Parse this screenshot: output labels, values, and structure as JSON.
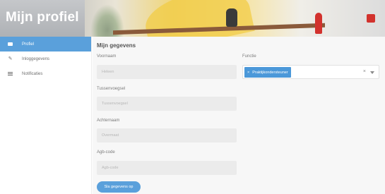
{
  "header": {
    "title": "Mijn profiel"
  },
  "sidebar": {
    "items": [
      {
        "label": "Profiel",
        "icon": "card-icon",
        "active": true
      },
      {
        "label": "Inloggegevens",
        "icon": "pencil-icon",
        "active": false
      },
      {
        "label": "Notificaties",
        "icon": "list-icon",
        "active": false
      }
    ]
  },
  "main": {
    "section_title": "Mijn gegevens",
    "fields": {
      "voornaam": {
        "label": "Voornaam",
        "value": "Heleen"
      },
      "tussenvoegsel": {
        "label": "Tussenvoegsel",
        "value": "Tussenvoegsel"
      },
      "achternaam": {
        "label": "Achternaam",
        "value": "Overmaat"
      },
      "agb": {
        "label": "Agb-code",
        "value": "Agb-code"
      }
    },
    "functie": {
      "label": "Functie",
      "selected_tag": "Praktijkondersteuner",
      "tag_remove": "×",
      "clear": "×"
    },
    "save_label": "Sla gegevens op"
  },
  "colors": {
    "accent": "#5aa0db",
    "tag": "#4b98d9",
    "field_bg": "#ebebeb"
  }
}
